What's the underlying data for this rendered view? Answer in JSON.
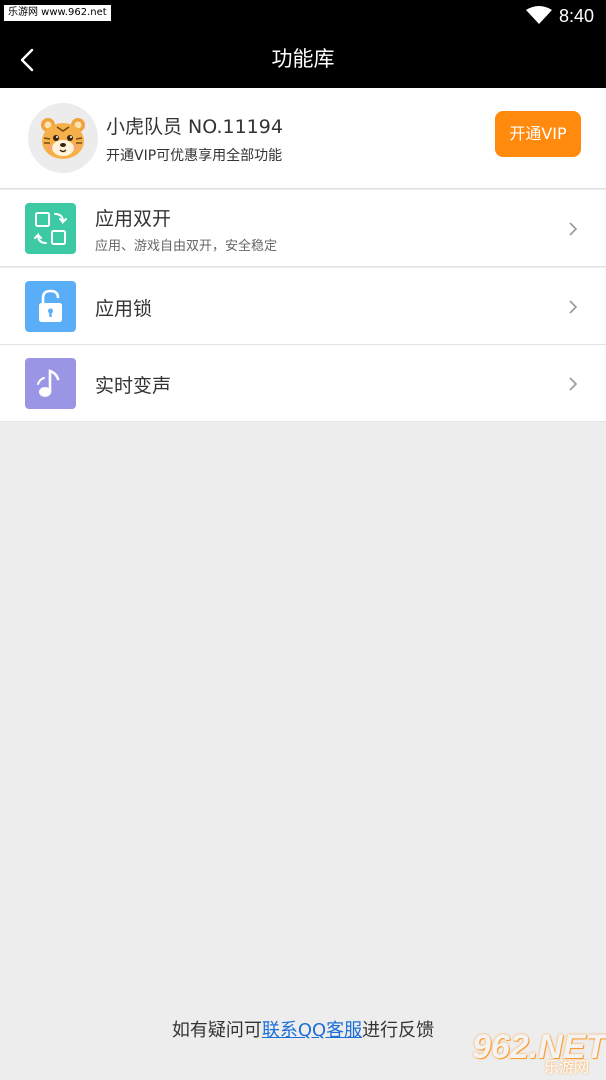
{
  "status_bar": {
    "watermark": "乐游网 www.962.net",
    "time": "8:40"
  },
  "app_bar": {
    "title": "功能库"
  },
  "profile": {
    "name": "小虎队员 NO.11194",
    "subtitle": "开通VIP可优惠享用全部功能",
    "vip_button": "开通VIP"
  },
  "features": [
    {
      "title": "应用双开",
      "description": "应用、游戏自由双开，安全稳定",
      "icon": "dual-app-icon",
      "color": "#3dc9a3"
    },
    {
      "title": "应用锁",
      "description": "",
      "icon": "lock-icon",
      "color": "#5aaef7"
    },
    {
      "title": "实时变声",
      "description": "",
      "icon": "music-note-icon",
      "color": "#9b95e6"
    }
  ],
  "footer": {
    "prefix": "如有疑问可",
    "link": "联系QQ客服",
    "suffix": "进行反馈"
  },
  "watermark_logo": {
    "big": "962.NET",
    "small": "乐游网"
  }
}
